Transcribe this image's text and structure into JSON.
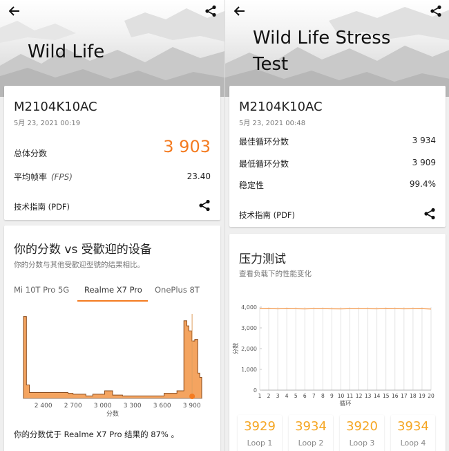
{
  "left": {
    "hero_title": "Wild Life",
    "result": {
      "device": "M2104K10AC",
      "date": "5月 23, 2021 00:19",
      "overall_label": "总体分数",
      "overall_value": "3 903",
      "fps_label": "平均帧率",
      "fps_unit": "(FPS)",
      "fps_value": "23.40",
      "tech_guide": "技术指南 (PDF)"
    },
    "comparison": {
      "title": "你的分数 vs 受歡迎的设备",
      "subtitle": "你的分数与其他受歡迎型號的结果相比。",
      "tabs": [
        {
          "label": "Mi 10T Pro 5G",
          "active": false
        },
        {
          "label": "Realme X7 Pro",
          "active": true
        },
        {
          "label": "OnePlus 8T",
          "active": false
        }
      ],
      "footer": "你的分数优于 Realme X7 Pro 结果的 87% 。"
    }
  },
  "right": {
    "hero_title_line1": "Wild Life Stress",
    "hero_title_line2": "Test",
    "result": {
      "device": "M2104K10AC",
      "date": "5月 23, 2021 00:48",
      "best_label": "最佳循环分数",
      "best_value": "3 934",
      "worst_label": "最低循环分数",
      "worst_value": "3 909",
      "stability_label": "稳定性",
      "stability_value": "99.4%",
      "tech_guide": "技术指南 (PDF)"
    },
    "stress": {
      "title": "压力测试",
      "subtitle": "查看负载下的性能变化",
      "loops": [
        {
          "value": "3929",
          "label": "Loop 1"
        },
        {
          "value": "3934",
          "label": "Loop 2"
        },
        {
          "value": "3920",
          "label": "Loop 3"
        },
        {
          "value": "3934",
          "label": "Loop 4"
        }
      ]
    }
  },
  "icons": {
    "back": "back-arrow-icon",
    "share": "share-icon"
  },
  "colors": {
    "accent": "#f47b20",
    "loop_value": "#f5a623",
    "histogram": "#f4a460"
  },
  "chart_data": [
    {
      "type": "area",
      "xlabel": "分数",
      "ylabel": "",
      "x_ticks": [
        "2 400",
        "2 700",
        "3 000",
        "3 300",
        "3 600",
        "3 900"
      ],
      "xlim": [
        2200,
        4000
      ],
      "your_score": 3903,
      "x": [
        2200,
        2215,
        2230,
        2260,
        2300,
        2400,
        2500,
        2600,
        2650,
        2700,
        2750,
        2800,
        2830,
        2850,
        2880,
        2900,
        2950,
        3000,
        3020,
        3050,
        3100,
        3200,
        3300,
        3400,
        3500,
        3600,
        3620,
        3650,
        3700,
        3750,
        3800,
        3820,
        3850,
        3870,
        3900,
        3930,
        3960,
        3980,
        4000
      ],
      "density": [
        0.97,
        0.97,
        0.16,
        0.07,
        0.07,
        0.07,
        0.07,
        0.07,
        0.06,
        0.05,
        0.05,
        0.05,
        0.03,
        0.03,
        0.03,
        0.05,
        0.05,
        0.05,
        0.09,
        0.09,
        0.04,
        0.03,
        0.03,
        0.03,
        0.03,
        0.03,
        0.06,
        0.06,
        0.06,
        0.09,
        0.09,
        0.92,
        0.86,
        0.8,
        0.68,
        0.7,
        0.3,
        0.25,
        0.25
      ]
    },
    {
      "type": "line",
      "xlabel": "循环",
      "ylabel": "分数",
      "y_ticks": [
        "0",
        "1,000",
        "2,000",
        "3,000",
        "4,000"
      ],
      "ylim": [
        0,
        4000
      ],
      "x_ticks": [
        "1",
        "2",
        "3",
        "4",
        "5",
        "6",
        "7",
        "8",
        "9",
        "10",
        "11",
        "12",
        "13",
        "14",
        "15",
        "16",
        "17",
        "18",
        "19",
        "20"
      ],
      "grid": true,
      "series": [
        {
          "values": [
            3929,
            3934,
            3920,
            3934,
            3925,
            3915,
            3928,
            3930,
            3922,
            3918,
            3931,
            3927,
            3924,
            3919,
            3933,
            3928,
            3921,
            3926,
            3930,
            3909
          ]
        }
      ]
    }
  ]
}
